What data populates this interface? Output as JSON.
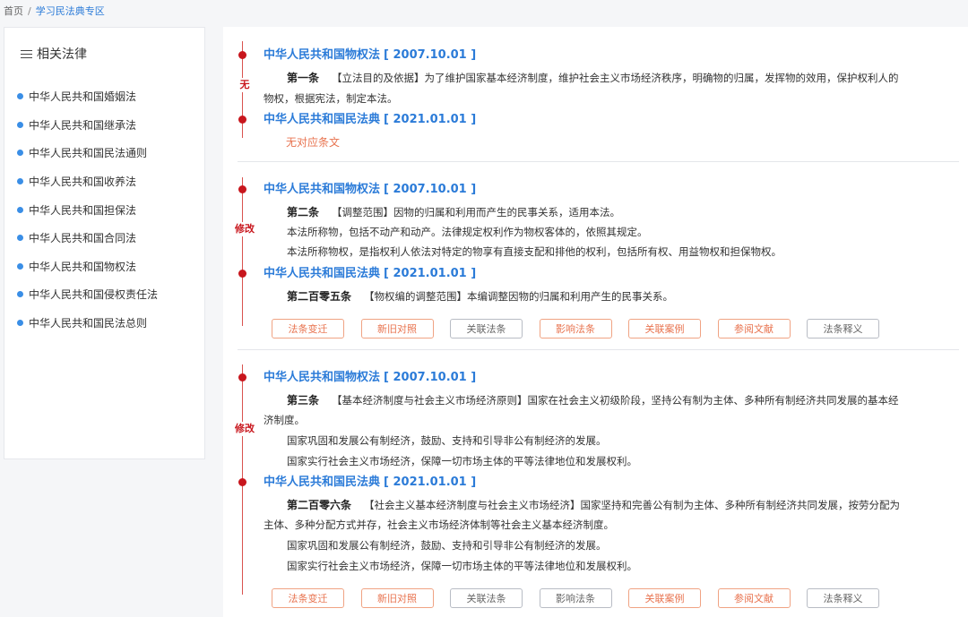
{
  "breadcrumb": {
    "home": "首页",
    "separator": "/",
    "current": "学习民法典专区"
  },
  "sidebar": {
    "title": "相关法律",
    "title_icon": "menu-icon",
    "items": [
      "中华人民共和国婚姻法",
      "中华人民共和国继承法",
      "中华人民共和国民法通则",
      "中华人民共和国收养法",
      "中华人民共和国担保法",
      "中华人民共和国合同法",
      "中华人民共和国物权法",
      "中华人民共和国侵权责任法",
      "中华人民共和国民法总则"
    ]
  },
  "sections": [
    {
      "tag": "无",
      "old_title": "中华人民共和国物权法",
      "old_date": "[ 2007.10.01 ]",
      "old_article": "第一条",
      "old_lines": [
        "【立法目的及依据】为了维护国家基本经济制度，维护社会主义市场经济秩序，明确物的归属，发挥物的效用，保护权利人的",
        "物权，根据宪法，制定本法。"
      ],
      "new_title": "中华人民共和国民法典",
      "new_date": "[ 2021.01.01 ]",
      "no_match": "无对应条文"
    },
    {
      "tag": "修改",
      "old_title": "中华人民共和国物权法",
      "old_date": "[ 2007.10.01 ]",
      "old_article": "第二条",
      "old_lines": [
        "【调整范围】因物的归属和利用而产生的民事关系，适用本法。",
        "本法所称物，包括不动产和动产。法律规定权利作为物权客体的，依照其规定。",
        "本法所称物权，是指权利人依法对特定的物享有直接支配和排他的权利，包括所有权、用益物权和担保物权。"
      ],
      "new_title": "中华人民共和国民法典",
      "new_date": "[ 2021.01.01 ]",
      "new_article": "第二百零五条",
      "new_lines": [
        "【物权编的调整范围】本编调整因物的归属和利用产生的民事关系。"
      ],
      "buttons": [
        "法条变迁",
        "新旧对照",
        "关联法条",
        "影响法条",
        "关联案例",
        "参阅文献",
        "法条释义"
      ]
    },
    {
      "tag": "修改",
      "old_title": "中华人民共和国物权法",
      "old_date": "[ 2007.10.01 ]",
      "old_article": "第三条",
      "old_lines": [
        "【基本经济制度与社会主义市场经济原则】国家在社会主义初级阶段，坚持公有制为主体、多种所有制经济共同发展的基本经",
        "济制度。",
        "国家巩固和发展公有制经济，鼓励、支持和引导非公有制经济的发展。",
        "国家实行社会主义市场经济，保障一切市场主体的平等法律地位和发展权利。"
      ],
      "new_title": "中华人民共和国民法典",
      "new_date": "[ 2021.01.01 ]",
      "new_article": "第二百零六条",
      "new_lines": [
        "【社会主义基本经济制度与社会主义市场经济】国家坚持和完善公有制为主体、多种所有制经济共同发展，按劳分配为",
        "主体、多种分配方式并存，社会主义市场经济体制等社会主义基本经济制度。",
        "国家巩固和发展公有制经济，鼓励、支持和引导非公有制经济的发展。",
        "国家实行社会主义市场经济，保障一切市场主体的平等法律地位和发展权利。"
      ],
      "buttons": [
        "法条变迁",
        "新旧对照",
        "关联法条",
        "影响法条",
        "关联案例",
        "参阅文献",
        "法条释义"
      ]
    }
  ],
  "colors": {
    "accent": "#2b7bd8",
    "timeline": "#c8161d",
    "orange": "#e8734f",
    "gray": "#666666"
  }
}
